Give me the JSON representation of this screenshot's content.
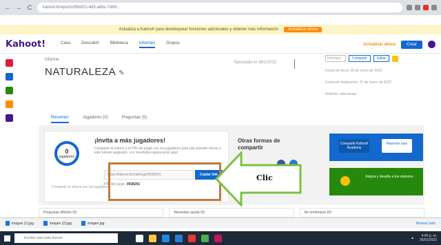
{
  "browser": {
    "url": "kahoot.it/reports/05b021-4d3-a6bc-7d89...",
    "nav": {
      "back": "←",
      "forward": "→",
      "reload": "C"
    }
  },
  "banner": {
    "text": "Actualiza a Kahoot! para desbloquear funciones adicionales y obtener más información",
    "button": "Actualizar ahora"
  },
  "header": {
    "logo": "Kahoot!",
    "nav": [
      "Casa",
      "Descubrir",
      "Biblioteca",
      "Informes",
      "Grupos"
    ],
    "upgrade": "Actualizar ahora",
    "create": "Crear"
  },
  "report": {
    "label": "Informe",
    "title": "NATURALEZA",
    "date": "Ejecutado el 26/1/2022",
    "right": {
      "select": "Informes",
      "btn1": "Compartir",
      "btn2": "Editar",
      "line1": "Fecha de inicio: 26 de enero de 2022",
      "line2": "Fecha de finalización: 27 de enero de 2022",
      "line3": "Anfitrión: kahootuser"
    }
  },
  "tabs": [
    "Resumen",
    "Jugadores (0)",
    "Preguntas (5)"
  ],
  "invite": {
    "count": "0",
    "count_label": "jugadores",
    "caption": "Comparte el enlace con tus jugadores",
    "title": "¡Invita a más jugadores!",
    "desc": "Comparte el enlace o el PIN del juego con tus jugadores para que puedan unirse a este kahoot asignado. Los resultados aparecerán aquí.",
    "link": "https://kahoot.it/challenge/0938291",
    "copy_button": "Copiar link",
    "pin_label": "PIN del juego:",
    "pin_value": "0938291"
  },
  "callout": {
    "label": "Clic"
  },
  "share": {
    "title": "Otras formas de compartir"
  },
  "promo": {
    "blue_btn1": "Compartir Kahoot! Academy",
    "blue_btn2": "Reportar aula",
    "green_text": "Asigna y desafía a tus alumnos"
  },
  "bottom_sections": [
    "Preguntas difíciles (0)",
    "Necesitan ayuda (0)",
    "No terminaron (0)"
  ],
  "downloads": {
    "items": [
      "imagen (1).jpg",
      "imagen (2).jpg",
      "imagen.jpg"
    ],
    "show_all": "Mostrar todo"
  },
  "taskbar": {
    "search": "Escribe aquí para buscar",
    "time": "4:45 p. m.",
    "date": "26/01/2022"
  }
}
